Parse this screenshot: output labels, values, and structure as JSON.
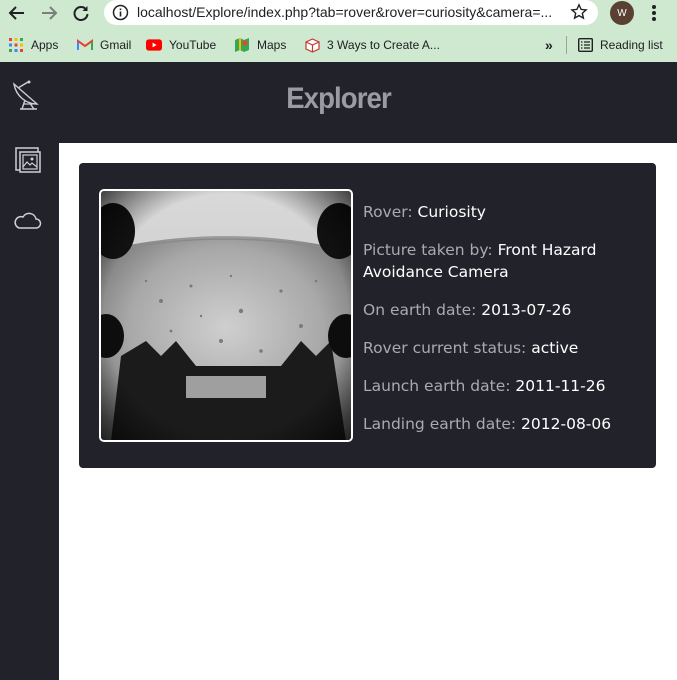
{
  "browser": {
    "url": "localhost/Explore/index.php?tab=rover&rover=curiosity&camera=...",
    "profile_initial": "W",
    "bookmarks": [
      {
        "label": "Apps",
        "icon": "apps-grid-icon"
      },
      {
        "label": "Gmail",
        "icon": "gmail-icon"
      },
      {
        "label": "YouTube",
        "icon": "youtube-icon"
      },
      {
        "label": "Maps",
        "icon": "maps-icon"
      },
      {
        "label": "3 Ways to Create A...",
        "icon": "box-icon"
      }
    ],
    "reading_list": "Reading list",
    "overflow": "»"
  },
  "app": {
    "title": "Explorer",
    "sidebar": [
      {
        "name": "satellite-dish-icon"
      },
      {
        "name": "gallery-icon"
      },
      {
        "name": "cloud-icon"
      }
    ]
  },
  "rover_card": {
    "image_description": "Mars surface photo",
    "rover_label": "Rover:",
    "rover_value": "Curiosity",
    "camera_label": "Picture taken by:",
    "camera_value": "Front Hazard Avoidance Camera",
    "earth_date_label": "On earth date:",
    "earth_date_value": "2013-07-26",
    "status_label": "Rover current status:",
    "status_value": "active",
    "launch_label": "Launch earth date:",
    "launch_value": "2011-11-26",
    "landing_label": "Landing earth date:",
    "landing_value": "2012-08-06"
  },
  "colors": {
    "chrome": "#cfe8d0",
    "app_dark": "#22222a",
    "title_grey": "#9a9ba4"
  }
}
